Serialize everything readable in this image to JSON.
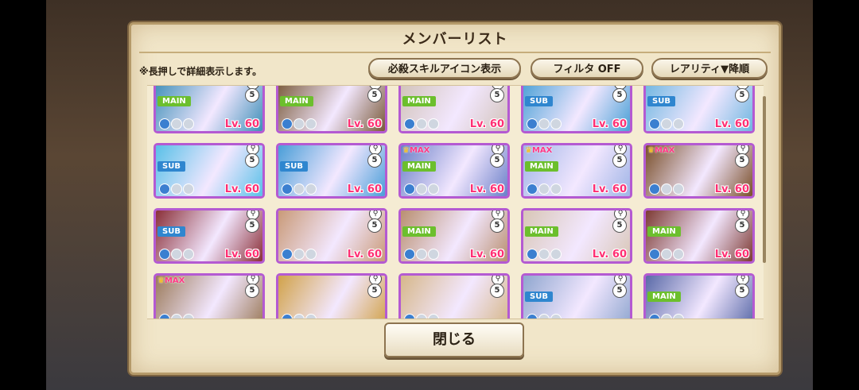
{
  "panel": {
    "title": "メンバーリスト",
    "hint": "※長押しで詳細表示します。",
    "buttons": {
      "skill_icon": "必殺スキルアイコン表示",
      "filter": "フィルタ OFF",
      "sort": "レアリティ▼降順"
    },
    "close_label": "閉じる"
  },
  "cards": [
    {
      "badge": "MAIN",
      "max": "",
      "lv": "Lv. 60",
      "count": "5",
      "art": "#3f8fb8",
      "frame": "#b45ad2"
    },
    {
      "badge": "MAIN",
      "max": "",
      "lv": "Lv. 60",
      "count": "5",
      "art": "#7a5a3a",
      "frame": "#b45ad2"
    },
    {
      "badge": "MAIN",
      "max": "",
      "lv": "Lv. 60",
      "count": "5",
      "art": "#d1c2b8",
      "frame": "#b45ad2"
    },
    {
      "badge": "SUB",
      "max": "",
      "lv": "Lv. 60",
      "count": "5",
      "art": "#4aa0d6",
      "frame": "#b45ad2"
    },
    {
      "badge": "SUB",
      "max": "",
      "lv": "Lv. 60",
      "count": "5",
      "art": "#6fb6e0",
      "frame": "#b45ad2"
    },
    {
      "badge": "SUB",
      "max": "",
      "lv": "Lv. 60",
      "count": "5",
      "art": "#59c0e8",
      "frame": "#b45ad2"
    },
    {
      "badge": "SUB",
      "max": "",
      "lv": "Lv. 60",
      "count": "5",
      "art": "#4a9ed8",
      "frame": "#b45ad2"
    },
    {
      "badge": "MAIN",
      "max": "MAX",
      "lv": "Lv. 60",
      "count": "5",
      "art": "#6a7fc8",
      "frame": "#b45ad2"
    },
    {
      "badge": "MAIN",
      "max": "MAX",
      "lv": "Lv. 60",
      "count": "5",
      "art": "#9fb4e6",
      "frame": "#b45ad2"
    },
    {
      "badge": "",
      "max": "MAX",
      "lv": "Lv. 60",
      "count": "5",
      "art": "#7a4f2a",
      "frame": "#b45ad2"
    },
    {
      "badge": "SUB",
      "max": "",
      "lv": "Lv. 60",
      "count": "5",
      "art": "#8a2f38",
      "frame": "#b45ad2"
    },
    {
      "badge": "",
      "max": "",
      "lv": "Lv. 60",
      "count": "5",
      "art": "#c99a78",
      "frame": "#b45ad2"
    },
    {
      "badge": "MAIN",
      "max": "",
      "lv": "Lv. 60",
      "count": "5",
      "art": "#b98f70",
      "frame": "#b45ad2"
    },
    {
      "badge": "MAIN",
      "max": "",
      "lv": "Lv. 60",
      "count": "5",
      "art": "#d8c6b6",
      "frame": "#b45ad2"
    },
    {
      "badge": "MAIN",
      "max": "",
      "lv": "Lv. 60",
      "count": "5",
      "art": "#7d3a33",
      "frame": "#b45ad2"
    },
    {
      "badge": "",
      "max": "MAX",
      "lv": "",
      "count": "5",
      "art": "#9b7a5a",
      "frame": "#b45ad2"
    },
    {
      "badge": "",
      "max": "",
      "lv": "",
      "count": "5",
      "art": "#d1a24a",
      "frame": "#b45ad2"
    },
    {
      "badge": "",
      "max": "",
      "lv": "",
      "count": "5",
      "art": "#d6b78a",
      "frame": "#b45ad2"
    },
    {
      "badge": "SUB",
      "max": "",
      "lv": "",
      "count": "5",
      "art": "#8fa6cf",
      "frame": "#b45ad2"
    },
    {
      "badge": "MAIN",
      "max": "",
      "lv": "",
      "count": "5",
      "art": "#5a6aa8",
      "frame": "#b45ad2"
    }
  ]
}
